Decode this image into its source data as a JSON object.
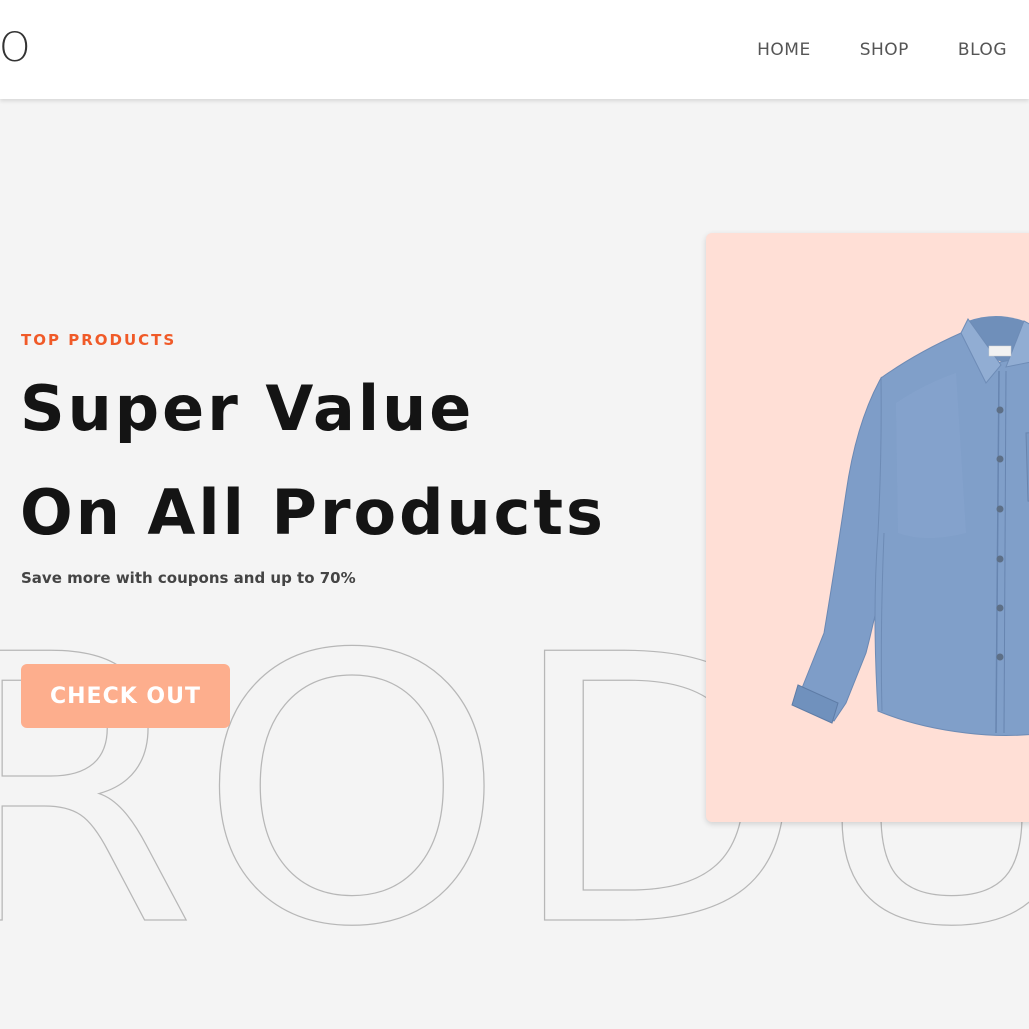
{
  "header": {
    "logo": "GO",
    "nav": [
      {
        "label": "HOME"
      },
      {
        "label": "SHOP"
      },
      {
        "label": "BLOG"
      }
    ]
  },
  "hero": {
    "eyebrow": "TOP PRODUCTS",
    "headline_line1": "Super Value",
    "headline_line2": "On All Products",
    "subtext": "Save more with coupons and up to 70%",
    "cta_label": "CHECK OUT",
    "watermark_text": "RODU"
  },
  "product": {
    "image_name": "denim-shirt-image"
  },
  "colors": {
    "accent": "#f05a28",
    "button": "#fdae8d",
    "card_background": "#ffdfd6",
    "page_background": "#f4f4f4",
    "shirt": "#7f9fc9"
  }
}
